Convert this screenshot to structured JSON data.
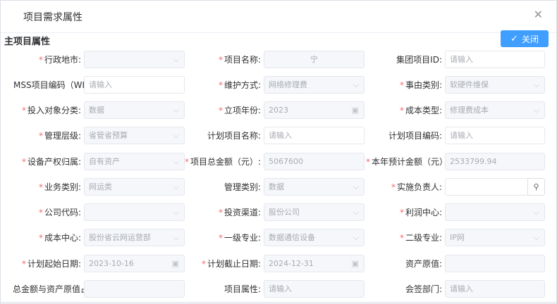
{
  "dialog": {
    "title": "项目需求属性",
    "close_icon": "close-icon"
  },
  "section": {
    "title": "主项目属性",
    "close_button": "关闭",
    "check_glyph": "✓"
  },
  "glyphs": {
    "chevron": "⌵",
    "calendar": "▣",
    "search": "⚲"
  },
  "fields": {
    "city": {
      "label": "行政地市:",
      "value": ""
    },
    "project_name": {
      "label": "项目名称:",
      "value": "宁"
    },
    "group_id": {
      "label": "集团项目ID:",
      "placeholder": "请输入"
    },
    "mss_code": {
      "label": "MSS项目编码（WBS编",
      "placeholder": "请输入"
    },
    "maint_mode": {
      "label": "维护方式:",
      "value": "网络修理费"
    },
    "reason_type": {
      "label": "事由类别:",
      "value": "软硬件维保"
    },
    "invest_class": {
      "label": "投入对象分类:",
      "value": "数据"
    },
    "year": {
      "label": "立项年份:",
      "value": "2023"
    },
    "cost_type": {
      "label": "成本类型:",
      "value": "修理费成本"
    },
    "mgmt_level": {
      "label": "管理层级:",
      "value": "省管省预算"
    },
    "plan_name": {
      "label": "计划项目名称:",
      "placeholder": "请输入"
    },
    "plan_code": {
      "label": "计划项目编码:",
      "placeholder": "请输入"
    },
    "ownership": {
      "label": "设备产权归属:",
      "value": "自有资产"
    },
    "total_amount": {
      "label": "项目总金额（元）:",
      "value": "5067600"
    },
    "year_estimate": {
      "label": "本年预计金额（元）",
      "value": "2533799.94"
    },
    "business_type": {
      "label": "业务类别:",
      "value": "网运类"
    },
    "mgmt_type": {
      "label": "管理类别:",
      "value": "数据"
    },
    "owner": {
      "label": "实施负责人:",
      "value": ""
    },
    "company_code": {
      "label": "公司代码:",
      "value": ""
    },
    "channel": {
      "label": "投资渠道:",
      "value": "股份公司"
    },
    "profit_center": {
      "label": "利润中心:",
      "value": ""
    },
    "cost_center": {
      "label": "成本中心:",
      "value": "股份省云网运营部"
    },
    "major1": {
      "label": "一级专业:",
      "value": "数据通信设备"
    },
    "major2": {
      "label": "二级专业:",
      "value": "IP网"
    },
    "start_date": {
      "label": "计划起始日期:",
      "value": "2023-10-16"
    },
    "end_date": {
      "label": "计划截止日期:",
      "value": "2024-12-31"
    },
    "asset_value": {
      "label": "资产原值:",
      "value": ""
    },
    "ratio": {
      "label": "总金额与资产原值占比",
      "value": ""
    },
    "project_attr": {
      "label": "项目属性:",
      "placeholder": "请输入"
    },
    "sign_dept": {
      "label": "会签部门:",
      "placeholder": "请输入"
    }
  }
}
